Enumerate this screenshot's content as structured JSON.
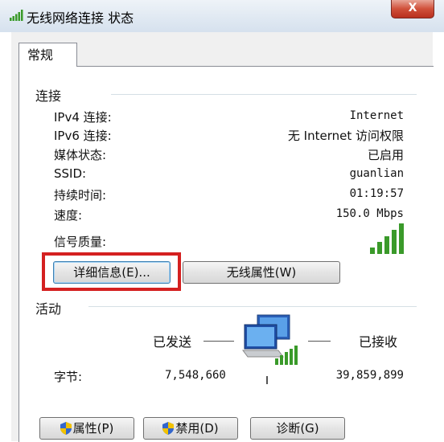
{
  "window": {
    "title": "无线网络连接 状态",
    "close_label": "X"
  },
  "tabs": [
    {
      "label": "常规"
    }
  ],
  "connection": {
    "heading": "连接",
    "rows": [
      {
        "label": "IPv4 连接:",
        "value": "Internet"
      },
      {
        "label": "IPv6 连接:",
        "value": "无 Internet 访问权限"
      },
      {
        "label": "媒体状态:",
        "value": "已启用"
      },
      {
        "label": "SSID:",
        "value": "guanlian"
      },
      {
        "label": "持续时间:",
        "value": "01:19:57"
      },
      {
        "label": "速度:",
        "value": "150.0 Mbps"
      }
    ],
    "signal_label": "信号质量:",
    "signal_bars": 5,
    "details_button": "详细信息(E)...",
    "wireless_props_button": "无线属性(W)"
  },
  "activity": {
    "heading": "活动",
    "sent_label": "已发送",
    "received_label": "已接收",
    "bytes_label": "字节:",
    "bytes_sent": "7,548,660",
    "bytes_received": "39,859,899"
  },
  "footer": {
    "properties_button": "属性(P)",
    "disable_button": "禁用(D)",
    "diagnose_button": "诊断(G)"
  },
  "colors": {
    "highlight": "#d42020",
    "signal_green": "#3a9a2a"
  }
}
